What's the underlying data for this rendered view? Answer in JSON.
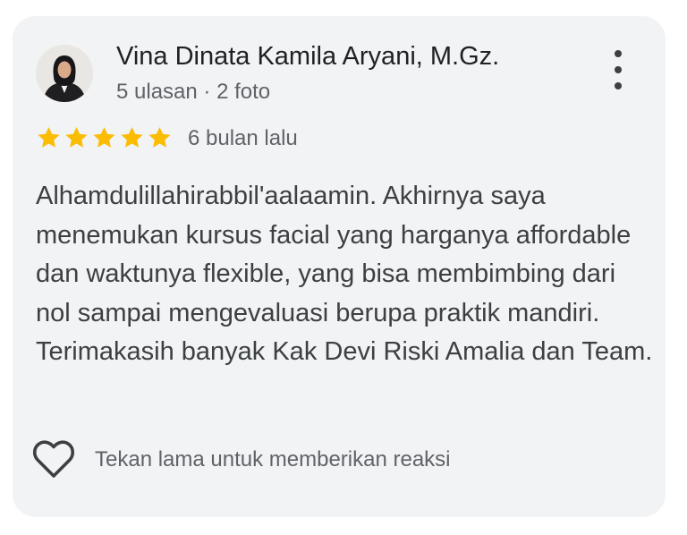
{
  "review": {
    "author_name": "Vina Dinata Kamila Aryani, M.Gz.",
    "author_meta": "5 ulasan · 2 foto",
    "rating": 5,
    "rating_max": 5,
    "date": "6 bulan lalu",
    "text": "Alhamdulillahirabbil'aalaamin. Akhirnya saya menemukan kursus facial yang harganya affordable dan waktunya flexible, yang bisa membimbing dari nol sampai mengevaluasi berupa praktik mandiri. Terimakasih banyak Kak Devi Riski Amalia dan Team.",
    "reaction_label": "Tekan lama untuk memberikan reaksi"
  },
  "icons": {
    "more": "more-vert-icon",
    "star": "star-icon",
    "heart": "heart-outline-icon"
  },
  "colors": {
    "card_background": "#f1f3f4",
    "star": "#fbbc04",
    "primary_text": "#202124",
    "secondary_text": "#5f6368"
  }
}
